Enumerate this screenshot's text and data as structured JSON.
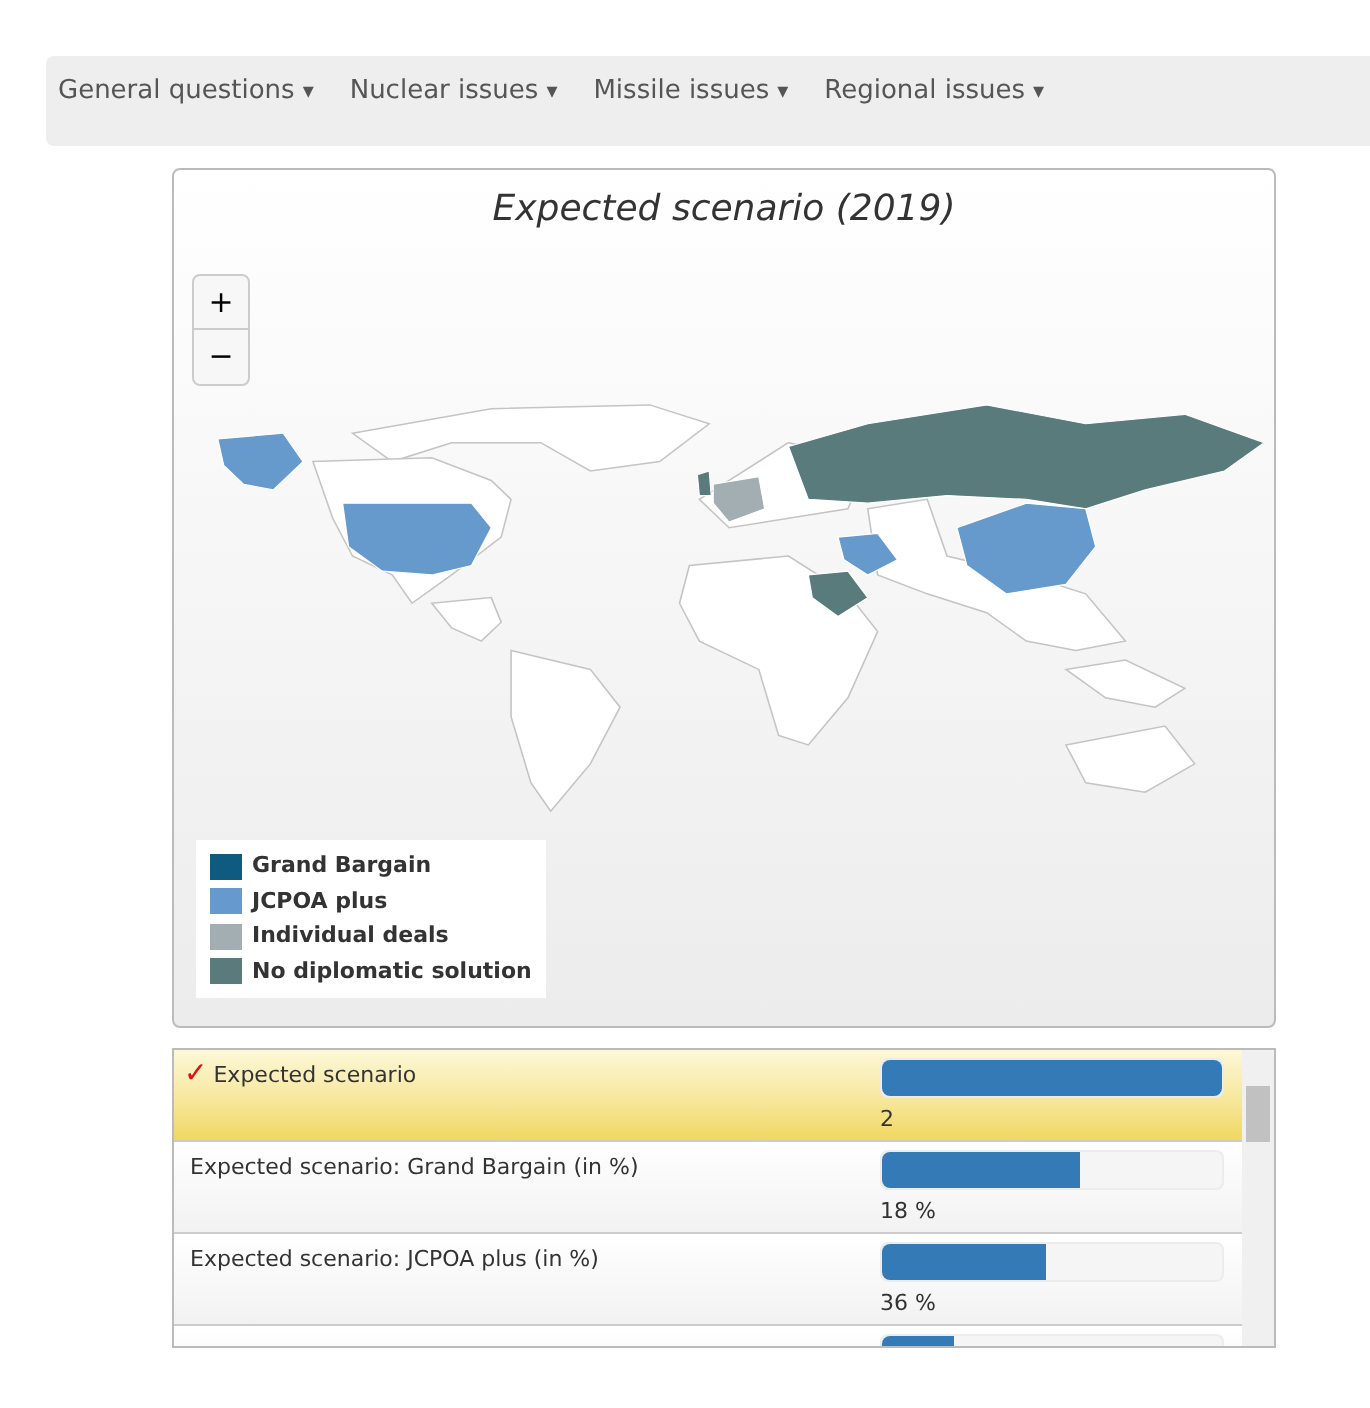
{
  "menu": [
    {
      "label": "General questions",
      "caret": "▾"
    },
    {
      "label": "Nuclear issues",
      "caret": "▾"
    },
    {
      "label": "Missile issues",
      "caret": "▾"
    },
    {
      "label": "Regional issues",
      "caret": "▾"
    }
  ],
  "map": {
    "title": "Expected scenario (2019)",
    "zoom_in": "+",
    "zoom_out": "−",
    "legend": [
      {
        "label": "Grand Bargain",
        "color": "#0f5a80"
      },
      {
        "label": "JCPOA plus",
        "color": "#6699cc"
      },
      {
        "label": "Individual deals",
        "color": "#a3aeb2"
      },
      {
        "label": "No diplomatic solution",
        "color": "#5a7b7b"
      }
    ]
  },
  "results": [
    {
      "label": "Expected scenario",
      "selected": true,
      "checkmark": "✓",
      "level": 1.0,
      "value": "2"
    },
    {
      "label": "Expected scenario: Grand Bargain (in %)",
      "selected": false,
      "level": 0.58,
      "value": "18 %"
    },
    {
      "label": "Expected scenario: JCPOA plus (in %)",
      "selected": false,
      "level": 0.48,
      "value": "36 %"
    },
    {
      "selected": false,
      "level": 0.21
    }
  ]
}
